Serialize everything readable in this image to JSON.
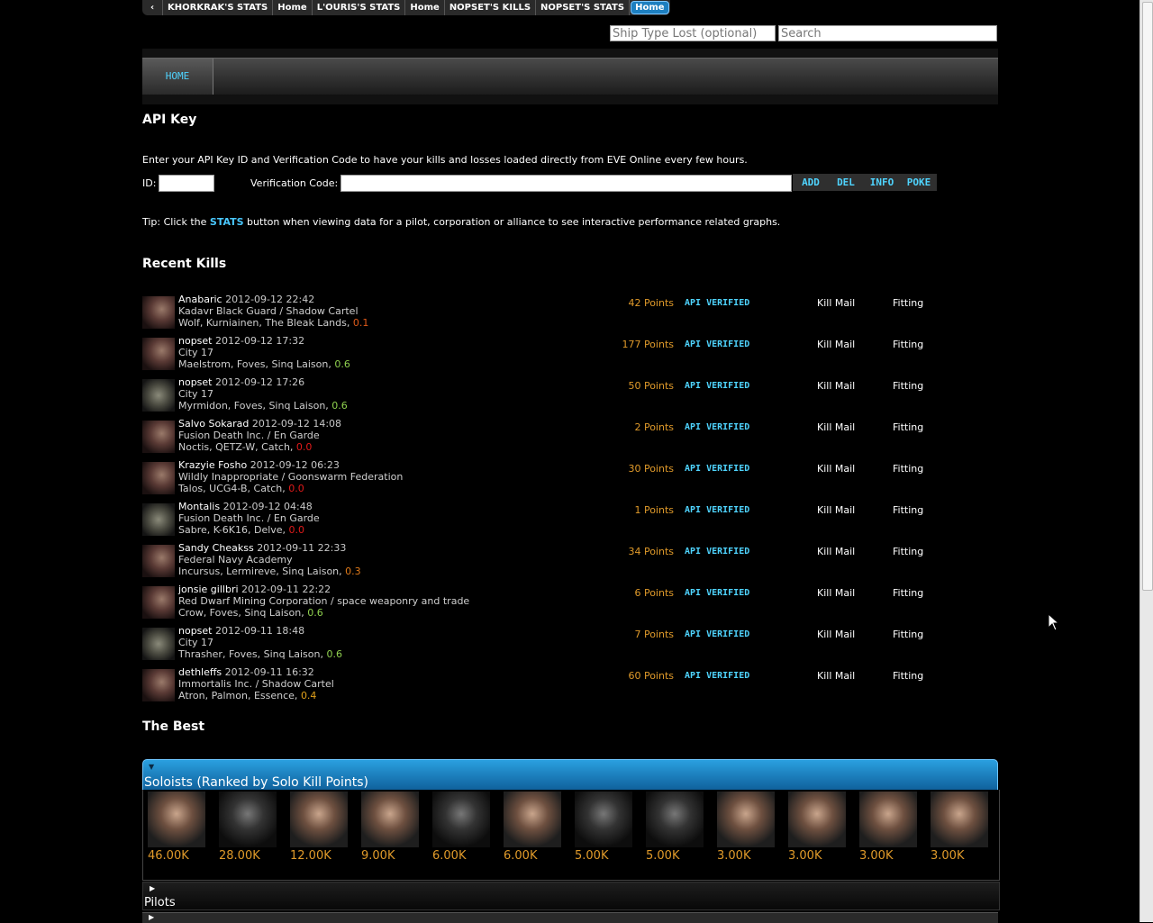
{
  "breadcrumbs": [
    "KHORKRAK'S STATS",
    "Home",
    "L'OURIS'S STATS",
    "Home",
    "NOPSET'S KILLS",
    "NOPSET'S STATS",
    "Home"
  ],
  "search": {
    "ship_placeholder": "Ship Type Lost (optional)",
    "search_placeholder": "Search"
  },
  "nav": {
    "home": "HOME"
  },
  "api": {
    "title": "API Key",
    "desc": "Enter your API Key ID and Verification Code to have your kills and losses loaded directly from EVE Online every few hours.",
    "id_label": "ID:",
    "vcode_label": "Verification Code:",
    "buttons": [
      "ADD",
      "DEL",
      "INFO",
      "POKE"
    ],
    "tip_pre": "Tip: Click the ",
    "tip_link": "STATS",
    "tip_post": " button when viewing data for a pilot, corporation or alliance to see interactive performance related graphs."
  },
  "recent_title": "Recent Kills",
  "kills": [
    {
      "name": "Anabaric",
      "date": "2012-09-12 22:42",
      "corp": "Kadavr Black Guard  / Shadow Cartel",
      "loc": "Wolf, Kurniainen, The Bleak Lands, ",
      "sec": "0.1",
      "sec_color": "#e05a1a",
      "points": "42 Points"
    },
    {
      "name": "nopset",
      "date": "2012-09-12 17:32",
      "corp": "City 17",
      "loc": "Maelstrom, Foves, Sinq Laison, ",
      "sec": "0.6",
      "sec_color": "#8fd14f",
      "points": "177 Points"
    },
    {
      "name": "nopset",
      "date": "2012-09-12 17:26",
      "corp": "City 17",
      "loc": "Myrmidon, Foves, Sinq Laison, ",
      "sec": "0.6",
      "sec_color": "#8fd14f",
      "points": "50 Points"
    },
    {
      "name": "Salvo Sokarad",
      "date": "2012-09-12 14:08",
      "corp": "Fusion Death Inc.  / En Garde",
      "loc": "Noctis, QETZ-W, Catch, ",
      "sec": "0.0",
      "sec_color": "#e01a1a",
      "points": "2 Points"
    },
    {
      "name": "Krazyie Fosho",
      "date": "2012-09-12 06:23",
      "corp": "Wildly Inappropriate  / Goonswarm Federation",
      "loc": "Talos, UCG4-B, Catch, ",
      "sec": "0.0",
      "sec_color": "#e01a1a",
      "points": "30 Points"
    },
    {
      "name": "Montalis",
      "date": "2012-09-12 04:48",
      "corp": "Fusion Death Inc.  / En Garde",
      "loc": "Sabre, K-6K16, Delve, ",
      "sec": "0.0",
      "sec_color": "#e01a1a",
      "points": "1 Points"
    },
    {
      "name": "Sandy Cheakss",
      "date": "2012-09-11 22:33",
      "corp": "Federal Navy Academy",
      "loc": "Incursus, Lermireve, Sinq Laison, ",
      "sec": "0.3",
      "sec_color": "#e07a1a",
      "points": "34 Points"
    },
    {
      "name": "jonsie gillbri",
      "date": "2012-09-11 22:22",
      "corp": "Red Dwarf Mining Corporation  / space weaponry and trade",
      "loc": "Crow, Foves, Sinq Laison, ",
      "sec": "0.6",
      "sec_color": "#8fd14f",
      "points": "6 Points"
    },
    {
      "name": "nopset",
      "date": "2012-09-11 18:48",
      "corp": "City 17",
      "loc": "Thrasher, Foves, Sinq Laison, ",
      "sec": "0.6",
      "sec_color": "#8fd14f",
      "points": "7 Points"
    },
    {
      "name": "dethleffs",
      "date": "2012-09-11 16:32",
      "corp": "Immortalis Inc.  / Shadow Cartel",
      "loc": "Atron, Palmon, Essence, ",
      "sec": "0.4",
      "sec_color": "#e0a01a",
      "points": "60 Points"
    }
  ],
  "kill_labels": {
    "api": "API VERIFIED",
    "killmail": "Kill Mail",
    "fitting": "Fitting"
  },
  "best_title": "The Best",
  "soloists": {
    "title": "Soloists (Ranked by Solo Kill Points)",
    "values": [
      "46.00K",
      "28.00K",
      "12.00K",
      "9.00K",
      "6.00K",
      "6.00K",
      "5.00K",
      "5.00K",
      "3.00K",
      "3.00K",
      "3.00K",
      "3.00K"
    ]
  },
  "pilots_label": "Pilots"
}
